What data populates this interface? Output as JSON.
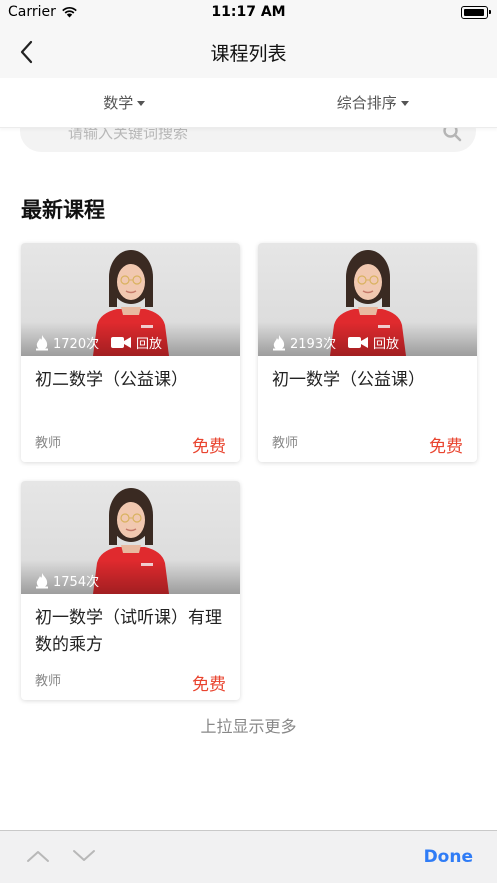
{
  "status_bar": {
    "carrier": "Carrier",
    "time": "11:17 AM"
  },
  "nav": {
    "title": "课程列表"
  },
  "filters": [
    {
      "label": "数学"
    },
    {
      "label": "综合排序"
    }
  ],
  "search": {
    "placeholder": "请输入关键词搜索"
  },
  "section": {
    "title": "最新课程"
  },
  "courses": [
    {
      "title": "初二数学（公益课）",
      "views": "1720次",
      "replay_label": "回放",
      "teacher": "教师",
      "price": "免费"
    },
    {
      "title": "初一数学（公益课）",
      "views": "2193次",
      "replay_label": "回放",
      "teacher": "教师",
      "price": "免费"
    },
    {
      "title": "初一数学（试听课）有理数的乘方",
      "views": "1754次",
      "teacher": "教师",
      "price": "免费"
    }
  ],
  "footer": {
    "load_more": "上拉显示更多"
  },
  "keyboard_toolbar": {
    "done_label": "Done"
  },
  "colors": {
    "accent": "#e9442f",
    "link": "#2f7cf6",
    "shirt": "#e02a2e"
  }
}
